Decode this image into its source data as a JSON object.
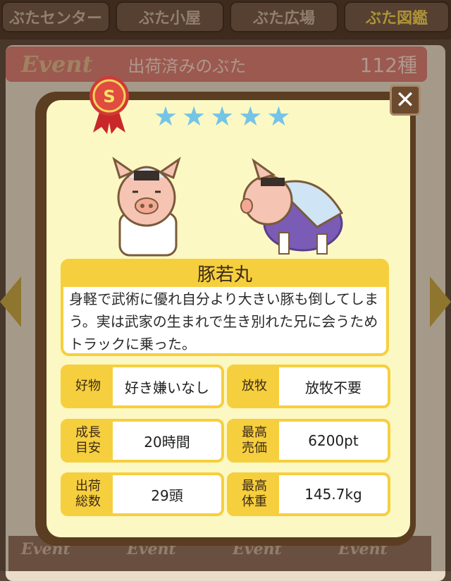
{
  "tabs": [
    {
      "label": "ぶたセンター"
    },
    {
      "label": "ぶた小屋"
    },
    {
      "label": "ぶた広場"
    },
    {
      "label": "ぶた図鑑",
      "active": true
    }
  ],
  "list_header": {
    "event_label": "Event",
    "title": "出荷済みのぶた",
    "count": "112種"
  },
  "bottom_row": {
    "event_labels": [
      "Event",
      "Event",
      "Event",
      "Event"
    ]
  },
  "card": {
    "rank": "S",
    "stars": 5,
    "star_color": "#74c4e6",
    "name": "豚若丸",
    "description": "身軽で武術に優れ自分より大きい豚も倒してしまう。実は武家の生まれで生き別れた兄に会うためトラックに乗った。",
    "stats": {
      "favorite": {
        "label": "好物",
        "value": "好き嫌いなし"
      },
      "grazing": {
        "label": "放牧",
        "value": "放牧不要"
      },
      "growth": {
        "label": "成長\n目安",
        "value": "20時間"
      },
      "max_price": {
        "label": "最高\n売価",
        "value": "6200pt"
      },
      "shipped": {
        "label": "出荷\n総数",
        "value": "29頭"
      },
      "max_weight": {
        "label": "最高\n体重",
        "value": "145.7kg"
      }
    }
  },
  "colors": {
    "accent": "#f6cf3e",
    "panel": "#fcf8c4",
    "frame": "#5b3d22",
    "header": "#d97a70"
  }
}
